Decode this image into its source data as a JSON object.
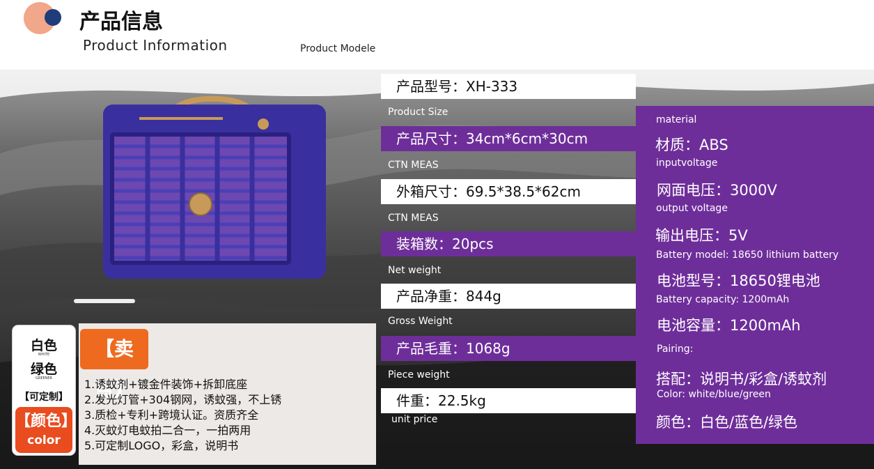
{
  "header": {
    "title_cn": "产品信息",
    "title_en": "Product Information",
    "model_label_en": "Product Modele"
  },
  "specs": [
    {
      "label_en": "",
      "text": "产品型号：XH-333",
      "style": "white"
    },
    {
      "label_en": "Product Size",
      "text": "产品尺寸：34cm*6cm*30cm",
      "style": "purple"
    },
    {
      "label_en": "CTN MEAS",
      "text": "外箱尺寸：69.5*38.5*62cm",
      "style": "white"
    },
    {
      "label_en": "CTN MEAS",
      "text": "装箱数：20pcs",
      "style": "purple"
    },
    {
      "label_en": "Net weight",
      "text": "产品净重：844g",
      "style": "white"
    },
    {
      "label_en": "Gross Weight",
      "text": "产品毛重：1068g",
      "style": "purple"
    },
    {
      "label_en": "Piece weight",
      "text": "件重：22.5kg",
      "style": "white"
    },
    {
      "label_en": "unit price",
      "text": "",
      "style": "none"
    }
  ],
  "panel": {
    "items": [
      {
        "en": "material",
        "cn": "材质：ABS"
      },
      {
        "en": "inputvoltage",
        "cn": "网面电压：3000V"
      },
      {
        "en": "output voltage",
        "cn": "输出电压：5V"
      },
      {
        "en": "Battery model: 18650 lithium battery",
        "cn": "电池型号：18650锂电池"
      },
      {
        "en": "Battery capacity: 1200mAh",
        "cn": "电池容量：1200mAh"
      },
      {
        "en": "Pairing:",
        "cn": "搭配：说明书/彩盒/诱蚊剂"
      },
      {
        "en": "Color: white/blue/green",
        "cn": "颜色：白色/蓝色/绿色"
      }
    ]
  },
  "color_box": {
    "line1_cn": "白色",
    "line1_en": "WHITE",
    "line2_cn": "绿色",
    "line2_en": "GREENER",
    "custom": "【可定制】",
    "tag_cn": "【颜色】",
    "tag_en": "color"
  },
  "selling": {
    "badge": "【卖点】",
    "items": [
      "1.诱蚊剂+镀金件装饰+拆卸底座",
      "2.发光灯管+304钢网，诱蚊强，不上锈",
      "3.质检+专利+跨境认证。资质齐全",
      "4.灭蚊灯电蚊拍二合一，一拍两用",
      "5.可定制LOGO，彩盒，说明书"
    ]
  },
  "colors": {
    "accent_purple": "#6e2e9a",
    "accent_orange": "#ee6a1f",
    "product_blue": "#3a2f9e"
  }
}
